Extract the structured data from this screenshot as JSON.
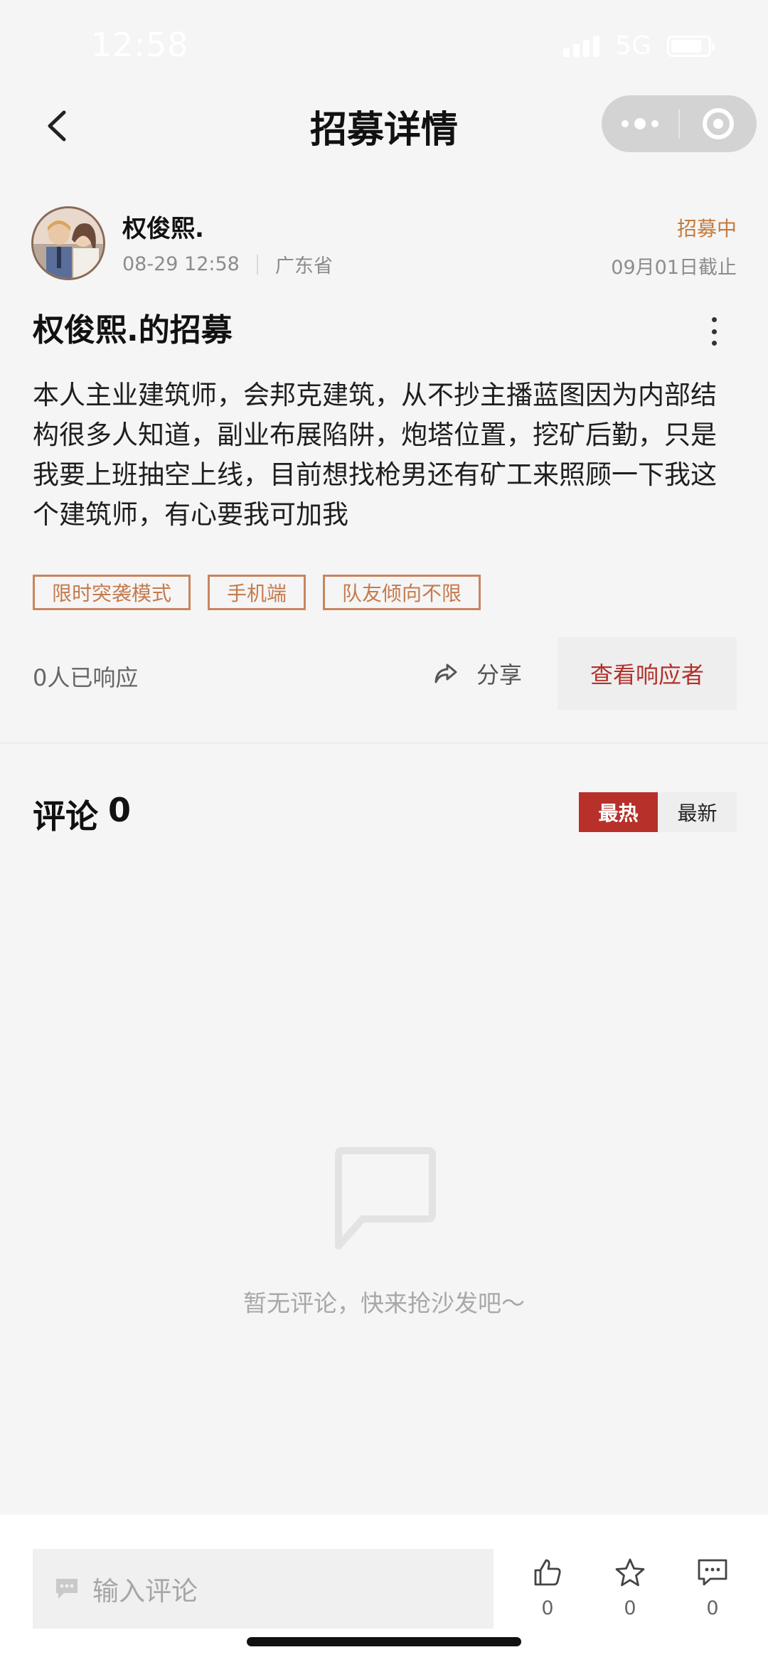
{
  "status_bar": {
    "time": "12:58",
    "network": "5G"
  },
  "nav": {
    "title": "招募详情"
  },
  "post": {
    "author": "权俊熙.",
    "date": "08-29 12:58",
    "location": "广东省",
    "status": "招募中",
    "deadline": "09月01日截止",
    "title": "权俊熙.的招募",
    "body": "本人主业建筑师，会邦克建筑，从不抄主播蓝图因为内部结构很多人知道，副业布展陷阱，炮塔位置，挖矿后勤，只是我要上班抽空上线，目前想找枪男还有矿工来照顾一下我这个建筑师，有心要我可加我",
    "tags": [
      "限时突袭模式",
      "手机端",
      "队友倾向不限"
    ],
    "responded": "0人已响应",
    "share_label": "分享",
    "view_responders": "查看响应者"
  },
  "comments": {
    "title": "评论",
    "count": "0",
    "sort_hot": "最热",
    "sort_new": "最新",
    "empty_text": "暂无评论，快来抢沙发吧～"
  },
  "bottom_bar": {
    "input_placeholder": "输入评论",
    "like_count": "0",
    "star_count": "0",
    "comment_count": "0"
  },
  "colors": {
    "accent_red": "#b8302a",
    "tag_orange": "#c57a4c",
    "background": "#f5f5f5"
  }
}
